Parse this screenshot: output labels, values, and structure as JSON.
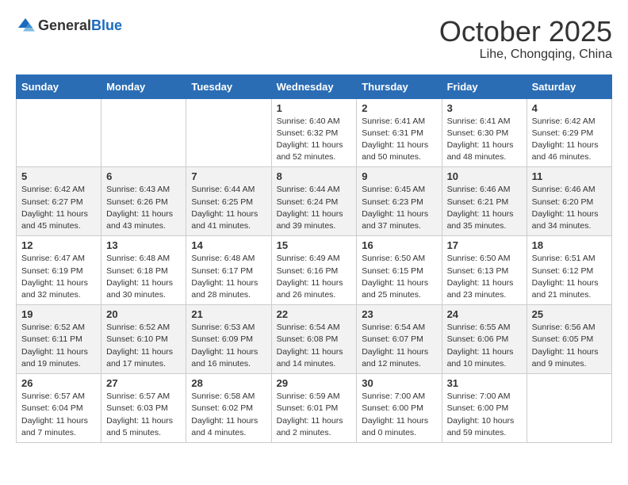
{
  "header": {
    "logo_general": "General",
    "logo_blue": "Blue",
    "month": "October 2025",
    "location": "Lihe, Chongqing, China"
  },
  "weekdays": [
    "Sunday",
    "Monday",
    "Tuesday",
    "Wednesday",
    "Thursday",
    "Friday",
    "Saturday"
  ],
  "weeks": [
    [
      {
        "day": "",
        "info": ""
      },
      {
        "day": "",
        "info": ""
      },
      {
        "day": "",
        "info": ""
      },
      {
        "day": "1",
        "info": "Sunrise: 6:40 AM\nSunset: 6:32 PM\nDaylight: 11 hours\nand 52 minutes."
      },
      {
        "day": "2",
        "info": "Sunrise: 6:41 AM\nSunset: 6:31 PM\nDaylight: 11 hours\nand 50 minutes."
      },
      {
        "day": "3",
        "info": "Sunrise: 6:41 AM\nSunset: 6:30 PM\nDaylight: 11 hours\nand 48 minutes."
      },
      {
        "day": "4",
        "info": "Sunrise: 6:42 AM\nSunset: 6:29 PM\nDaylight: 11 hours\nand 46 minutes."
      }
    ],
    [
      {
        "day": "5",
        "info": "Sunrise: 6:42 AM\nSunset: 6:27 PM\nDaylight: 11 hours\nand 45 minutes."
      },
      {
        "day": "6",
        "info": "Sunrise: 6:43 AM\nSunset: 6:26 PM\nDaylight: 11 hours\nand 43 minutes."
      },
      {
        "day": "7",
        "info": "Sunrise: 6:44 AM\nSunset: 6:25 PM\nDaylight: 11 hours\nand 41 minutes."
      },
      {
        "day": "8",
        "info": "Sunrise: 6:44 AM\nSunset: 6:24 PM\nDaylight: 11 hours\nand 39 minutes."
      },
      {
        "day": "9",
        "info": "Sunrise: 6:45 AM\nSunset: 6:23 PM\nDaylight: 11 hours\nand 37 minutes."
      },
      {
        "day": "10",
        "info": "Sunrise: 6:46 AM\nSunset: 6:21 PM\nDaylight: 11 hours\nand 35 minutes."
      },
      {
        "day": "11",
        "info": "Sunrise: 6:46 AM\nSunset: 6:20 PM\nDaylight: 11 hours\nand 34 minutes."
      }
    ],
    [
      {
        "day": "12",
        "info": "Sunrise: 6:47 AM\nSunset: 6:19 PM\nDaylight: 11 hours\nand 32 minutes."
      },
      {
        "day": "13",
        "info": "Sunrise: 6:48 AM\nSunset: 6:18 PM\nDaylight: 11 hours\nand 30 minutes."
      },
      {
        "day": "14",
        "info": "Sunrise: 6:48 AM\nSunset: 6:17 PM\nDaylight: 11 hours\nand 28 minutes."
      },
      {
        "day": "15",
        "info": "Sunrise: 6:49 AM\nSunset: 6:16 PM\nDaylight: 11 hours\nand 26 minutes."
      },
      {
        "day": "16",
        "info": "Sunrise: 6:50 AM\nSunset: 6:15 PM\nDaylight: 11 hours\nand 25 minutes."
      },
      {
        "day": "17",
        "info": "Sunrise: 6:50 AM\nSunset: 6:13 PM\nDaylight: 11 hours\nand 23 minutes."
      },
      {
        "day": "18",
        "info": "Sunrise: 6:51 AM\nSunset: 6:12 PM\nDaylight: 11 hours\nand 21 minutes."
      }
    ],
    [
      {
        "day": "19",
        "info": "Sunrise: 6:52 AM\nSunset: 6:11 PM\nDaylight: 11 hours\nand 19 minutes."
      },
      {
        "day": "20",
        "info": "Sunrise: 6:52 AM\nSunset: 6:10 PM\nDaylight: 11 hours\nand 17 minutes."
      },
      {
        "day": "21",
        "info": "Sunrise: 6:53 AM\nSunset: 6:09 PM\nDaylight: 11 hours\nand 16 minutes."
      },
      {
        "day": "22",
        "info": "Sunrise: 6:54 AM\nSunset: 6:08 PM\nDaylight: 11 hours\nand 14 minutes."
      },
      {
        "day": "23",
        "info": "Sunrise: 6:54 AM\nSunset: 6:07 PM\nDaylight: 11 hours\nand 12 minutes."
      },
      {
        "day": "24",
        "info": "Sunrise: 6:55 AM\nSunset: 6:06 PM\nDaylight: 11 hours\nand 10 minutes."
      },
      {
        "day": "25",
        "info": "Sunrise: 6:56 AM\nSunset: 6:05 PM\nDaylight: 11 hours\nand 9 minutes."
      }
    ],
    [
      {
        "day": "26",
        "info": "Sunrise: 6:57 AM\nSunset: 6:04 PM\nDaylight: 11 hours\nand 7 minutes."
      },
      {
        "day": "27",
        "info": "Sunrise: 6:57 AM\nSunset: 6:03 PM\nDaylight: 11 hours\nand 5 minutes."
      },
      {
        "day": "28",
        "info": "Sunrise: 6:58 AM\nSunset: 6:02 PM\nDaylight: 11 hours\nand 4 minutes."
      },
      {
        "day": "29",
        "info": "Sunrise: 6:59 AM\nSunset: 6:01 PM\nDaylight: 11 hours\nand 2 minutes."
      },
      {
        "day": "30",
        "info": "Sunrise: 7:00 AM\nSunset: 6:00 PM\nDaylight: 11 hours\nand 0 minutes."
      },
      {
        "day": "31",
        "info": "Sunrise: 7:00 AM\nSunset: 6:00 PM\nDaylight: 10 hours\nand 59 minutes."
      },
      {
        "day": "",
        "info": ""
      }
    ]
  ]
}
